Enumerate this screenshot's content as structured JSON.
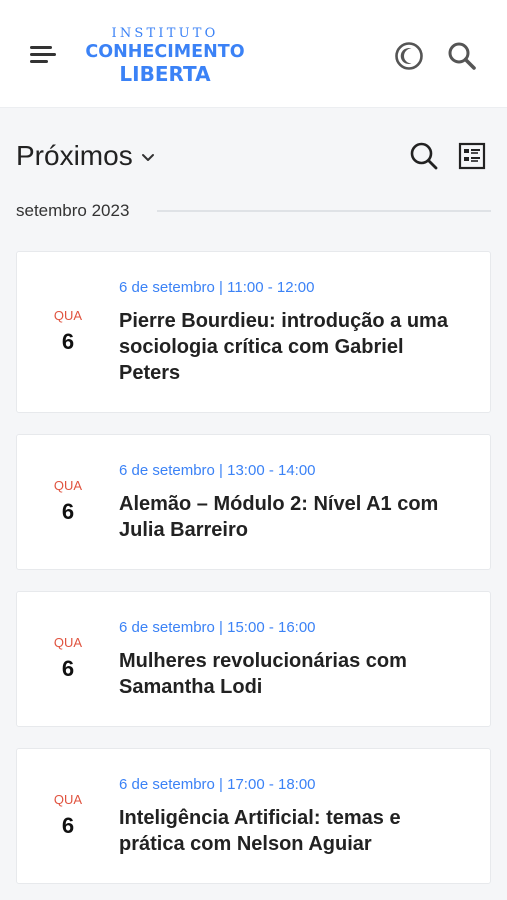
{
  "header": {
    "logo": {
      "line1": "INSTITUTO",
      "line2": "CONHECIMENTO",
      "line3": "LIBERTA"
    },
    "icons": {
      "menu": "hamburger-menu-icon",
      "dark_mode": "dark-mode-toggle-icon",
      "search": "search-icon"
    }
  },
  "toolbar": {
    "view_label": "Próximos",
    "icons": {
      "dropdown": "chevron-down-icon",
      "search": "search-icon",
      "layout": "list-view-icon"
    }
  },
  "month": {
    "label": "setembro 2023"
  },
  "events": [
    {
      "dow": "QUA",
      "day": "6",
      "time": "6 de setembro | 11:00 - 12:00",
      "title": "Pierre Bourdieu: introdução a uma sociologia crítica com Gabriel Peters"
    },
    {
      "dow": "QUA",
      "day": "6",
      "time": "6 de setembro | 13:00 - 14:00",
      "title": "Alemão – Módulo 2: Nível A1 com Julia Barreiro"
    },
    {
      "dow": "QUA",
      "day": "6",
      "time": "6 de setembro | 15:00 - 16:00",
      "title": "Mulheres revolucionárias com Samantha Lodi"
    },
    {
      "dow": "QUA",
      "day": "6",
      "time": "6 de setembro | 17:00 - 18:00",
      "title": "Inteligência Artificial: temas e prática com Nelson Aguiar"
    }
  ],
  "colors": {
    "accent": "#3b82f6",
    "weekday": "#e0533f",
    "background": "#f5f6f8"
  }
}
